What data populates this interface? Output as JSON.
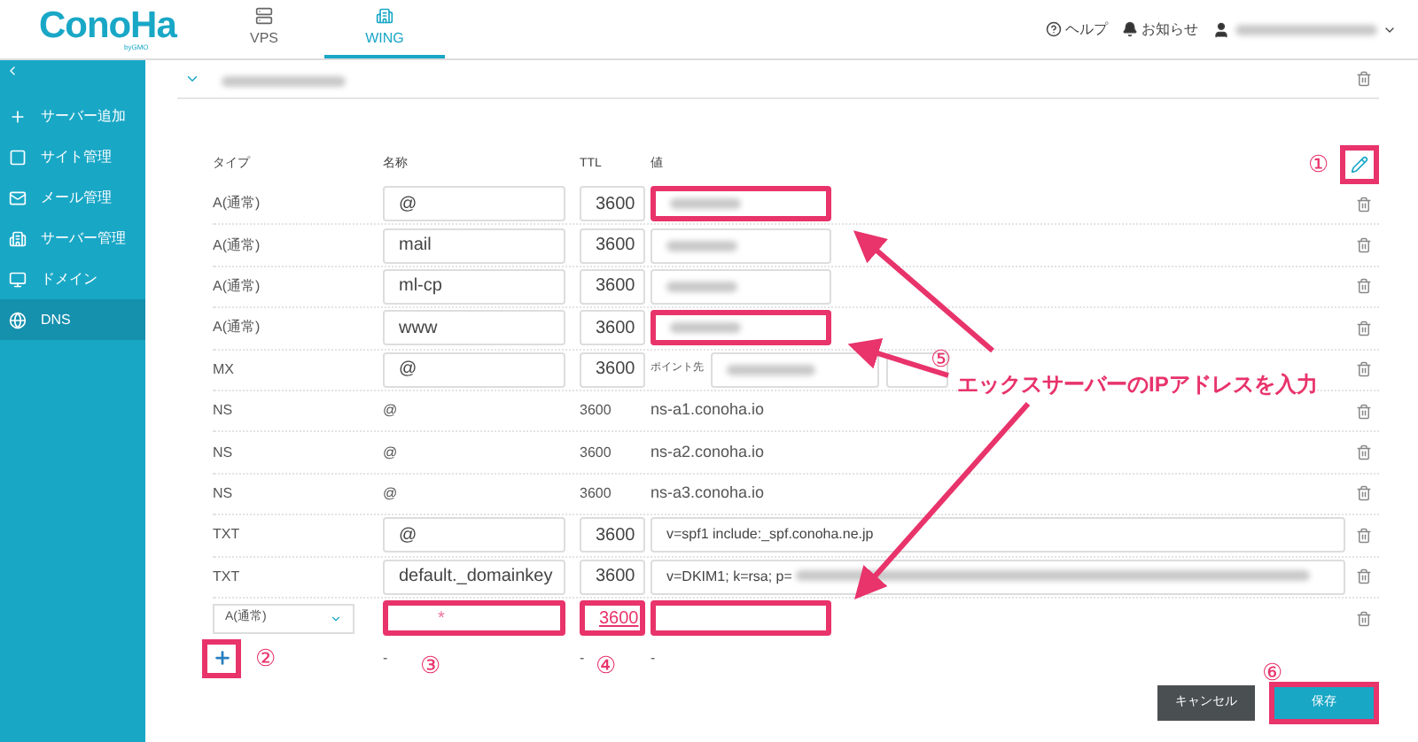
{
  "header": {
    "logo": "ConoHa",
    "logo_sub": "byGMO",
    "tabs": [
      {
        "label": "VPS",
        "selected": false
      },
      {
        "label": "WING",
        "selected": true
      }
    ],
    "help": "ヘルプ",
    "notices": "お知らせ"
  },
  "sidebar": {
    "items": [
      {
        "label": "サーバー追加",
        "selected": false
      },
      {
        "label": "サイト管理",
        "selected": false
      },
      {
        "label": "メール管理",
        "selected": false
      },
      {
        "label": "サーバー管理",
        "selected": false
      },
      {
        "label": "ドメイン",
        "selected": false
      },
      {
        "label": "DNS",
        "selected": true
      }
    ]
  },
  "table": {
    "edit_highlighted": true,
    "columns": [
      "タイプ",
      "名称",
      "TTL",
      "値"
    ],
    "rows": [
      {
        "kind": "a",
        "type": "A(通常)",
        "name": "@",
        "ttl": "3600",
        "highlighted": true
      },
      {
        "kind": "a",
        "type": "A(通常)",
        "name": "mail",
        "ttl": "3600",
        "highlighted": false
      },
      {
        "kind": "a",
        "type": "A(通常)",
        "name": "ml-cp",
        "ttl": "3600",
        "highlighted": false
      },
      {
        "kind": "a",
        "type": "A(通常)",
        "name": "www",
        "ttl": "3600",
        "highlighted": true
      },
      {
        "kind": "mx",
        "type": "MX",
        "name": "@",
        "ttl": "3600",
        "point_label": "ポイント先"
      },
      {
        "kind": "static",
        "type": "NS",
        "name": "@",
        "ttl": "3600",
        "value": "ns-a1.conoha.io"
      },
      {
        "kind": "static",
        "type": "NS",
        "name": "@",
        "ttl": "3600",
        "value": "ns-a2.conoha.io"
      },
      {
        "kind": "static",
        "type": "NS",
        "name": "@",
        "ttl": "3600",
        "value": "ns-a3.conoha.io"
      },
      {
        "kind": "txt",
        "type": "TXT",
        "name": "@",
        "ttl": "3600",
        "value": "v=spf1 include:_spf.conoha.ne.jp",
        "blurred_tail": false
      },
      {
        "kind": "txt",
        "type": "TXT",
        "name": "default._domainkey",
        "ttl": "3600",
        "value": "v=DKIM1; k=rsa; p=",
        "blurred_tail": true
      }
    ],
    "new_row": {
      "type": "A(通常)",
      "name_placeholder": "*",
      "ttl": "3600",
      "highlighted": true,
      "dashes": [
        "-",
        "-",
        "-"
      ]
    },
    "add_highlighted": true
  },
  "actions": {
    "cancel": "キャンセル",
    "save": "保存",
    "save_highlighted": true
  },
  "annotations": {
    "steps": [
      "①",
      "②",
      "③",
      "④",
      "⑤",
      "⑥"
    ],
    "callout": "エックスサーバーのIPアドレスを入力"
  }
}
